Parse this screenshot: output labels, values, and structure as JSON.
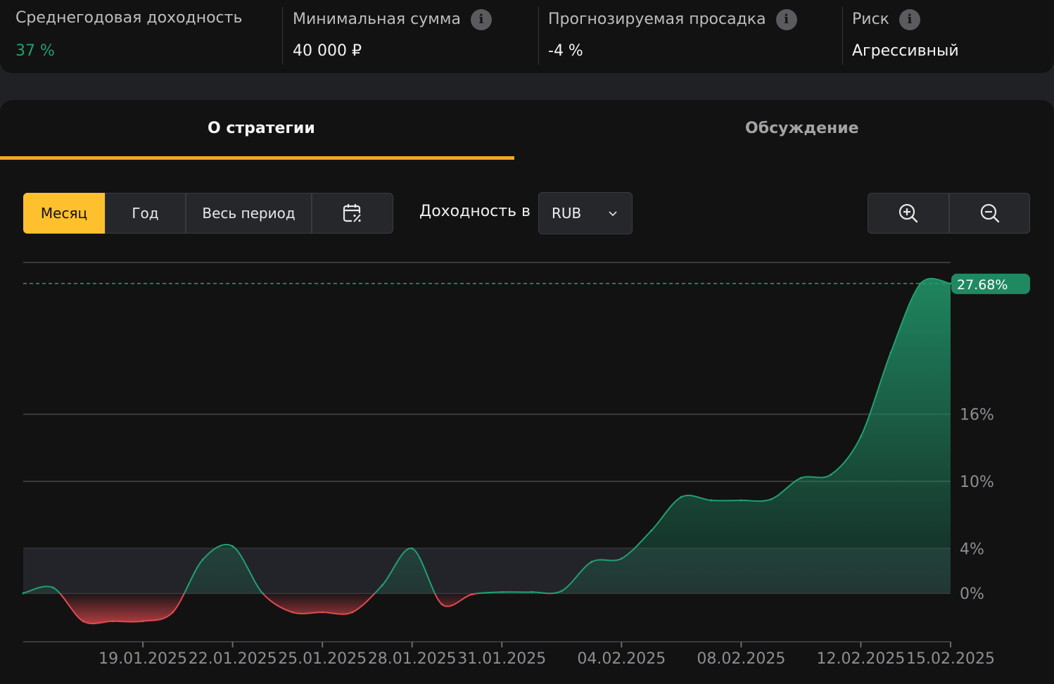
{
  "stats": [
    {
      "label": "Среднегодовая доходность",
      "value": "37 %",
      "info": false,
      "value_color": "#21a06f"
    },
    {
      "label": "Минимальная сумма",
      "value": "40 000 ₽",
      "info": true
    },
    {
      "label": "Прогнозируемая просадка",
      "value": "-4 %",
      "info": true
    },
    {
      "label": "Риск",
      "value": "Агрессивный",
      "info": true
    }
  ],
  "tabs": {
    "active": "О стратегии",
    "inactive": "Обсуждение"
  },
  "period": {
    "month": "Месяц",
    "year": "Год",
    "all": "Весь период",
    "calendar_icon": "calendar-percent-icon"
  },
  "currency": {
    "label": "Доходность в",
    "value": "RUB"
  },
  "zoom": {
    "in_icon": "zoom-in-icon",
    "out_icon": "zoom-out-icon"
  },
  "colors": {
    "accent": "#ffc02e",
    "tab_underline": "#f5a623",
    "positive": "#21a06f",
    "negative": "#e04a4f"
  },
  "chart_data": {
    "type": "area",
    "current_value_label": "27.68%",
    "y_ticks": [
      {
        "value": 0,
        "label": "0%"
      },
      {
        "value": 4,
        "label": "4%"
      },
      {
        "value": 10,
        "label": "10%"
      },
      {
        "value": 16,
        "label": "16%"
      }
    ],
    "ylim": [
      -4.4,
      29.5
    ],
    "x_ticks": [
      {
        "x": 3,
        "label": "19.01.2025"
      },
      {
        "x": 6,
        "label": "22.01.2025"
      },
      {
        "x": 9,
        "label": "25.01.2025"
      },
      {
        "x": 12,
        "label": "28.01.2025"
      },
      {
        "x": 15,
        "label": "31.01.2025"
      },
      {
        "x": 19,
        "label": "04.02.2025"
      },
      {
        "x": 23,
        "label": "08.02.2025"
      },
      {
        "x": 27,
        "label": "12.02.2025"
      },
      {
        "x": 30,
        "label": "15.02.2025"
      }
    ],
    "xlim": [
      -1,
      30
    ],
    "points": [
      [
        -1,
        0.0
      ],
      [
        0,
        0.5
      ],
      [
        1,
        -2.5
      ],
      [
        2,
        -2.5
      ],
      [
        3,
        -2.5
      ],
      [
        4,
        -1.7
      ],
      [
        5,
        3.0
      ],
      [
        6,
        4.2
      ],
      [
        7,
        0.0
      ],
      [
        8,
        -1.7
      ],
      [
        9,
        -1.7
      ],
      [
        10,
        -1.7
      ],
      [
        11,
        0.7
      ],
      [
        12,
        4.0
      ],
      [
        13,
        -1.0
      ],
      [
        14,
        -0.1
      ],
      [
        15,
        0.1
      ],
      [
        16,
        0.1
      ],
      [
        17,
        0.2
      ],
      [
        18,
        2.8
      ],
      [
        19,
        3.1
      ],
      [
        20,
        5.6
      ],
      [
        21,
        8.6
      ],
      [
        22,
        8.3
      ],
      [
        23,
        8.3
      ],
      [
        24,
        8.4
      ],
      [
        25,
        10.3
      ],
      [
        26,
        10.6
      ],
      [
        27,
        14.0
      ],
      [
        28,
        21.5
      ],
      [
        29,
        27.68
      ],
      [
        30,
        27.68
      ]
    ]
  }
}
